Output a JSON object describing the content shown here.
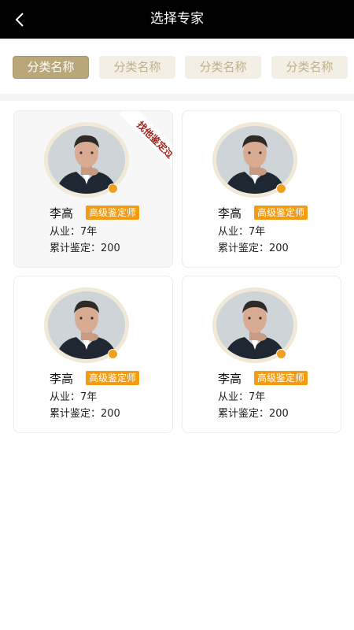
{
  "header": {
    "title": "选择专家",
    "back_icon": "chevron-left-icon"
  },
  "tabs": [
    {
      "label": "分类名称",
      "active": true
    },
    {
      "label": "分类名称",
      "active": false
    },
    {
      "label": "分类名称",
      "active": false
    },
    {
      "label": "分类名称",
      "active": false
    }
  ],
  "experts": [
    {
      "name": "李高",
      "title": "高级鉴定师",
      "experience_label": "从业：",
      "experience": "7年",
      "count_label": "累计鉴定：",
      "count": "200",
      "ribbon": "找他鉴定过"
    },
    {
      "name": "李高",
      "title": "高级鉴定师",
      "experience_label": "从业：",
      "experience": "7年",
      "count_label": "累计鉴定：",
      "count": "200"
    },
    {
      "name": "李高",
      "title": "高级鉴定师",
      "experience_label": "从业：",
      "experience": "7年",
      "count_label": "累计鉴定：",
      "count": "200"
    },
    {
      "name": "李高",
      "title": "高级鉴定师",
      "experience_label": "从业：",
      "experience": "7年",
      "count_label": "累计鉴定：",
      "count": "200"
    }
  ],
  "colors": {
    "header_bg": "#000000",
    "tab_active": "#b9a77a",
    "tab_inactive": "#f3efe4",
    "tag_orange": "#f39c12",
    "ribbon_text": "#a1231c"
  }
}
